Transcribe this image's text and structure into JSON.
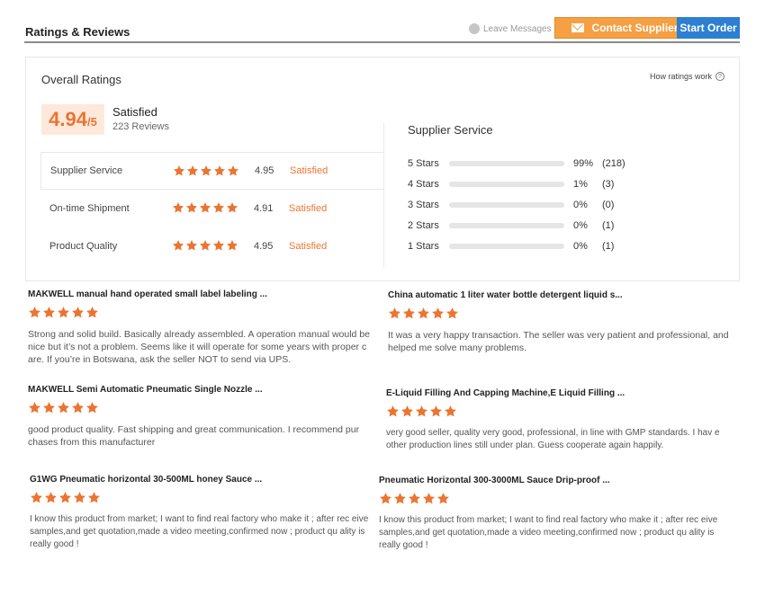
{
  "header": {
    "title": "Ratings & Reviews",
    "leave_messages": "Leave Messages",
    "contact_supplier": "Contact Supplier",
    "start_order": "Start Order"
  },
  "overall": {
    "title": "Overall Ratings",
    "how_ratings_work": "How ratings work",
    "score": "4.94",
    "score_denominator": "/5",
    "status": "Satisfied",
    "review_count": "223 Reviews",
    "categories": [
      {
        "label": "Supplier Service",
        "score": "4.95",
        "status": "Satisfied",
        "stars": 5
      },
      {
        "label": "On-time Shipment",
        "score": "4.91",
        "status": "Satisfied",
        "stars": 5
      },
      {
        "label": "Product Quality",
        "score": "4.95",
        "status": "Satisfied",
        "stars": 5
      }
    ]
  },
  "supplier_service": {
    "title": "Supplier Service",
    "distribution": [
      {
        "label": "5 Stars",
        "percent": 99,
        "percent_text": "99%",
        "count": "(218)"
      },
      {
        "label": "4 Stars",
        "percent": 1,
        "percent_text": "1%",
        "count": "(3)"
      },
      {
        "label": "3 Stars",
        "percent": 0,
        "percent_text": "0%",
        "count": "(0)"
      },
      {
        "label": "2 Stars",
        "percent": 0,
        "percent_text": "0%",
        "count": "(1)"
      },
      {
        "label": "1 Stars",
        "percent": 0,
        "percent_text": "0%",
        "count": "(1)"
      }
    ]
  },
  "reviews": [
    {
      "title": "MAKWELL manual hand operated small label labeling ...",
      "stars": 5,
      "text": "Strong and solid build. Basically already assembled. A operation manual would be nice but it’s not a problem. Seems like it will operate for some years with proper c are. If you’re in Botswana, ask the seller NOT to send via UPS."
    },
    {
      "title": "China automatic 1 liter water bottle detergent liquid s...",
      "stars": 5,
      "text": "It was a very happy transaction. The seller was very patient and professional, and helped me solve many problems."
    },
    {
      "title": "MAKWELL Semi Automatic Pneumatic Single Nozzle ...",
      "stars": 5,
      "text": "good product quality.  Fast shipping and great communication.  I recommend pur chases from this manufacturer"
    },
    {
      "title": "E-Liquid Filling And Capping Machine,E Liquid Filling ...",
      "stars": 5,
      "text": "very good seller, quality very good, professional, in line with GMP standards. I hav e other production lines still under plan. Guess cooperate again happily."
    },
    {
      "title": "G1WG Pneumatic horizontal 30-500ML honey Sauce ...",
      "stars": 5,
      "text": "I know this product from market; I want to find real factory who make it ; after rec eive samples,and get quotation,made a video meeting,confirmed now ; product qu ality is really good !"
    },
    {
      "title": "Pneumatic Horizontal 300-3000ML Sauce Drip-proof ...",
      "stars": 5,
      "text": "I know this product from market; I want to find real factory who make it ; after rec eive samples,and get quotation,made a video meeting,confirmed now ; product qu ality is really good !"
    }
  ],
  "colors": {
    "accent": "#ec7431",
    "contact_button": "#f5a044",
    "order_button": "#2c7fd1"
  }
}
